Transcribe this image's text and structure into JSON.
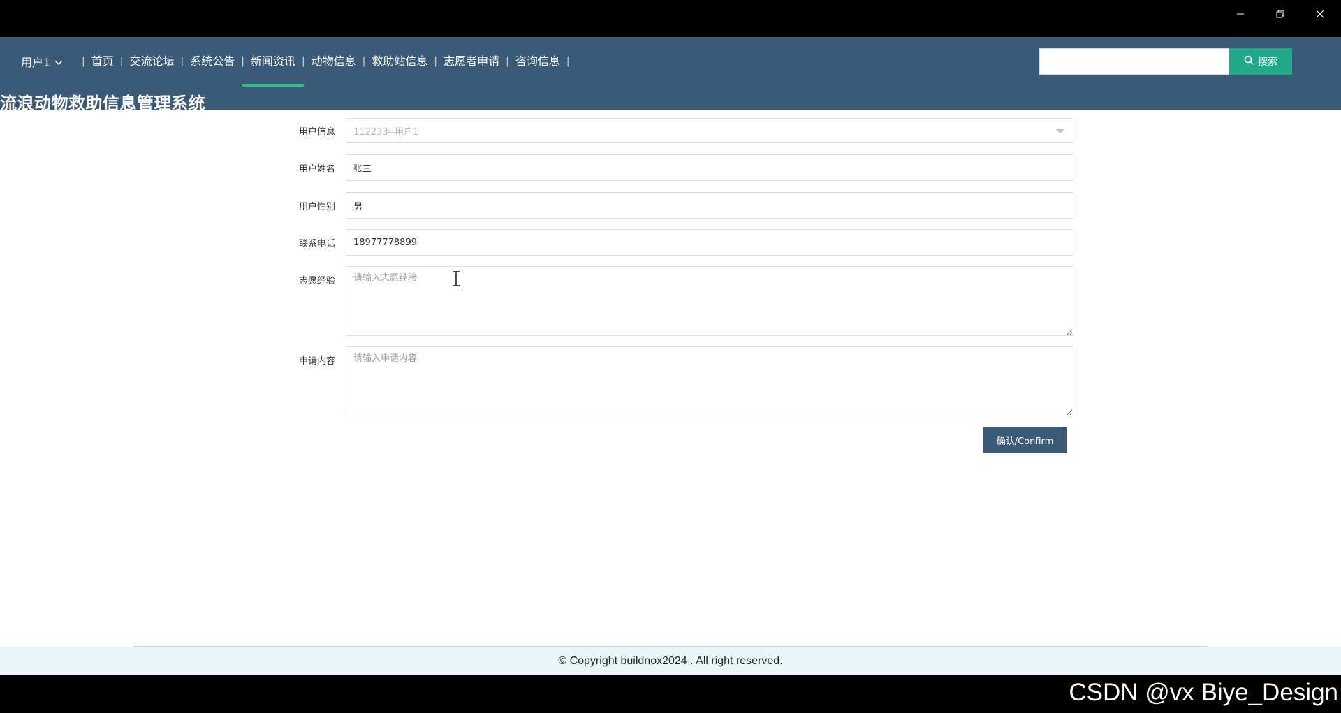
{
  "window": {
    "controls": [
      "minimize",
      "restore",
      "close"
    ]
  },
  "header": {
    "user_menu_label": "用户1",
    "nav_items": [
      {
        "label": "首页"
      },
      {
        "label": "交流论坛"
      },
      {
        "label": "系统公告"
      },
      {
        "label": "新闻资讯",
        "active": true
      },
      {
        "label": "动物信息"
      },
      {
        "label": "救助站信息"
      },
      {
        "label": "志愿者申请"
      },
      {
        "label": "咨询信息"
      }
    ],
    "site_title": "流浪动物救助信息管理系统",
    "search": {
      "value": "",
      "button_label": "搜索"
    }
  },
  "form": {
    "user_info": {
      "label": "用户信息",
      "value": "112233--用户1"
    },
    "user_name": {
      "label": "用户姓名",
      "value": "张三"
    },
    "user_gender": {
      "label": "用户性别",
      "value": "男"
    },
    "phone": {
      "label": "联系电话",
      "value": "18977778899"
    },
    "experience": {
      "label": "志愿经验",
      "placeholder": "请输入志愿经验"
    },
    "content": {
      "label": "申请内容",
      "placeholder": "请输入申请内容"
    },
    "confirm_label": "确认/Confirm"
  },
  "footer": {
    "copyright": "© Copyright buildnox2024 . All right reserved."
  },
  "watermark": "CSDN @vx Biye_Design",
  "colors": {
    "header_bg": "#3a5a78",
    "active_underline": "#3cb68c",
    "search_button": "#22a78a",
    "confirm_button": "#3a5a78",
    "footer_bg": "#eaf5f7"
  }
}
